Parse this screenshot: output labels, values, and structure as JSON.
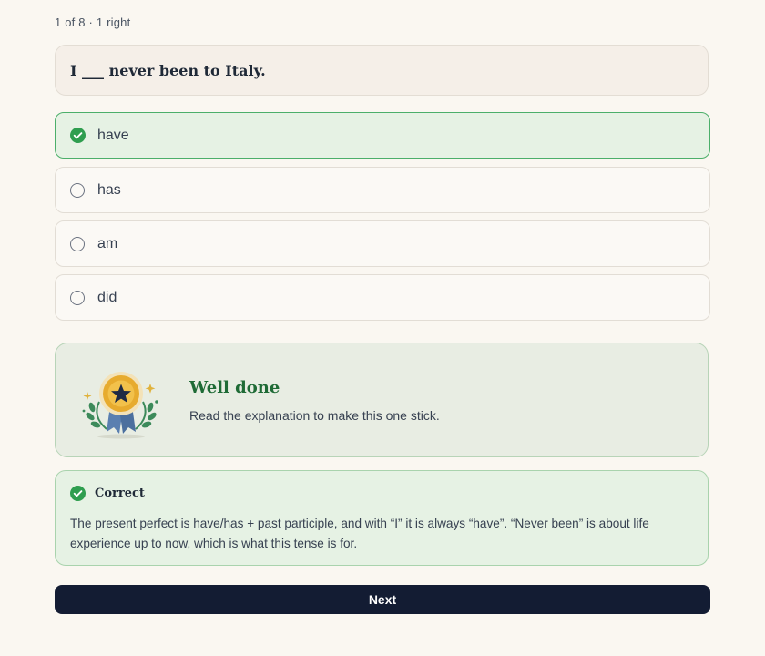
{
  "progress": "1 of 8 · 1 right",
  "question": "I ___ never been to Italy.",
  "options": [
    {
      "label": "have",
      "selected": true
    },
    {
      "label": "has",
      "selected": false
    },
    {
      "label": "am",
      "selected": false
    },
    {
      "label": "did",
      "selected": false
    }
  ],
  "feedback": {
    "title": "Well done",
    "subtitle": "Read the explanation to make this one stick."
  },
  "explanation": {
    "status": "Correct",
    "body": "The present perfect is have/has + past participle, and with “I” it is always “have”. “Never been” is about life experience up to now, which is what this tense is for."
  },
  "next_label": "Next",
  "icons": {
    "check": "check-circle-icon",
    "radio": "radio-empty-icon",
    "medal": "medal-icon"
  },
  "colors": {
    "success": "#2f9e4f",
    "success_bg": "#e6f2e4",
    "button": "#131c33",
    "background": "#faf7f1"
  }
}
